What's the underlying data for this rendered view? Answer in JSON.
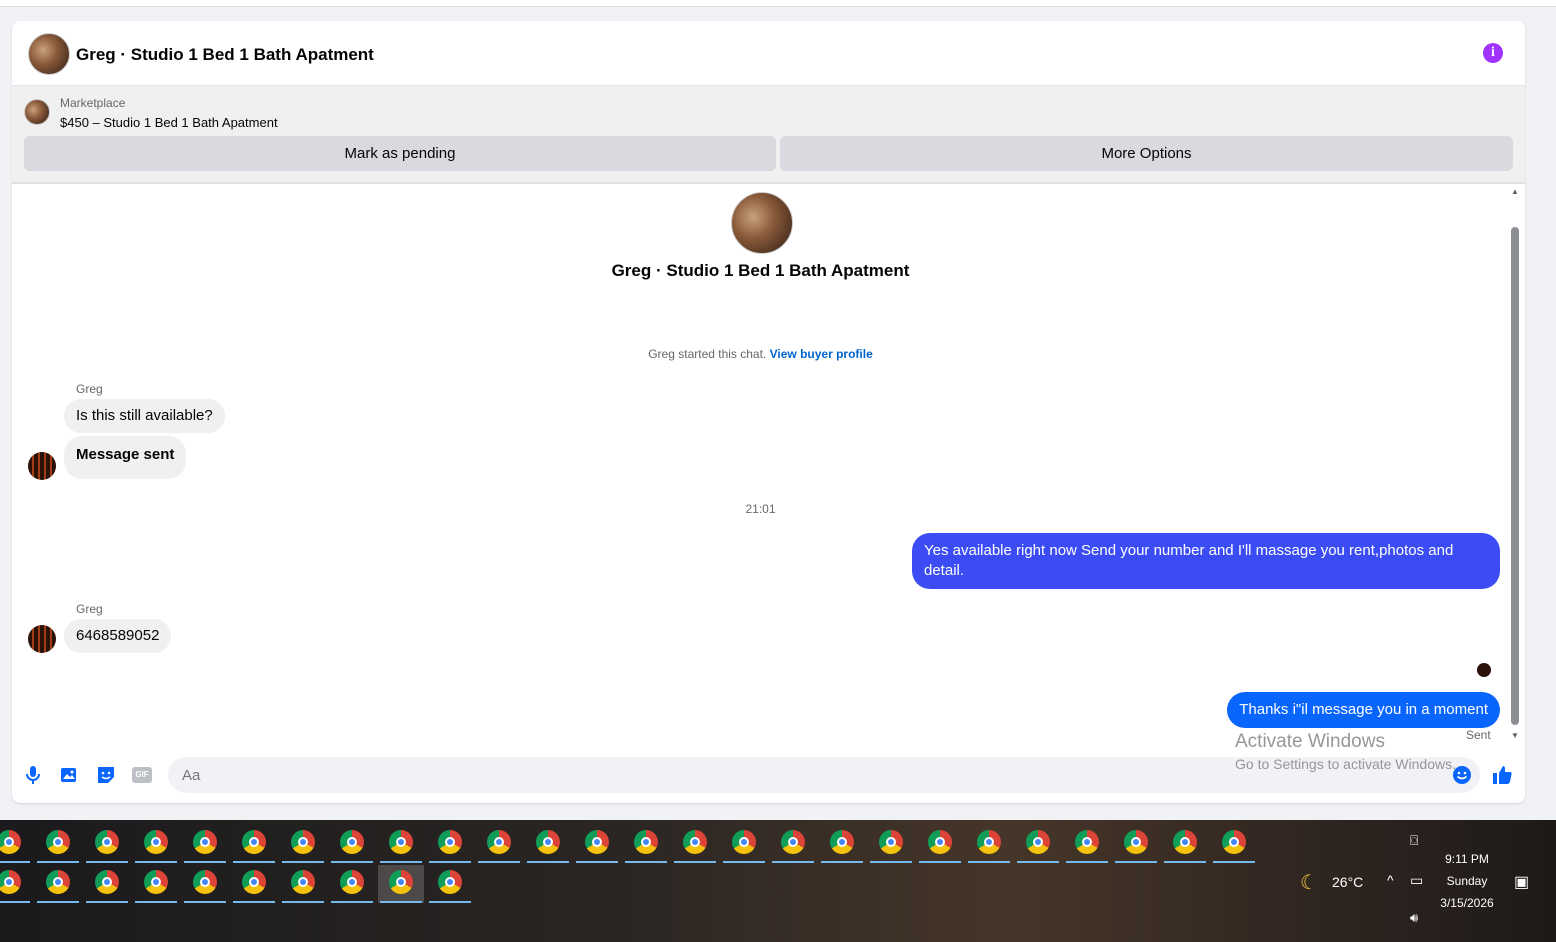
{
  "header": {
    "title": "Greg · Studio 1 Bed 1 Bath Apatment",
    "info_icon": "info-icon"
  },
  "listing": {
    "source": "Marketplace",
    "price_title": "$450 – Studio 1 Bed 1 Bath Apatment",
    "pending_label": "Mark as pending",
    "more_label": "More Options"
  },
  "chat": {
    "title": "Greg · Studio 1 Bed 1 Bath Apatment",
    "started_text": "Greg started this chat.",
    "view_profile": "View buyer profile",
    "sender_name": "Greg",
    "msg1": "Is this still available?",
    "msg2": "Message sent",
    "time": "21:01",
    "out1": "Yes available right now Send your number and I'll massage you rent,photos and detail.",
    "sender_name2": "Greg",
    "msg3": "6468589052",
    "out2": "Thanks i\"il message you in a moment",
    "status": "Sent",
    "colors": {
      "outgoing1": "#3b4cf5",
      "outgoing2": "#0866ff",
      "incoming": "#f0f0f0",
      "link": "#0064d1"
    }
  },
  "composer": {
    "placeholder": "Aa",
    "icons": [
      "microphone-icon",
      "photo-icon",
      "sticker-icon",
      "gif-icon",
      "emoji-icon",
      "like-icon"
    ],
    "gif_label": "GIF"
  },
  "watermark": {
    "line1": "Activate Windows",
    "line2": "Go to Settings to activate Windows."
  },
  "taskbar": {
    "weather": "26°C",
    "time": "9:11 PM",
    "day": "Sunday",
    "date": "3/15/2026"
  }
}
